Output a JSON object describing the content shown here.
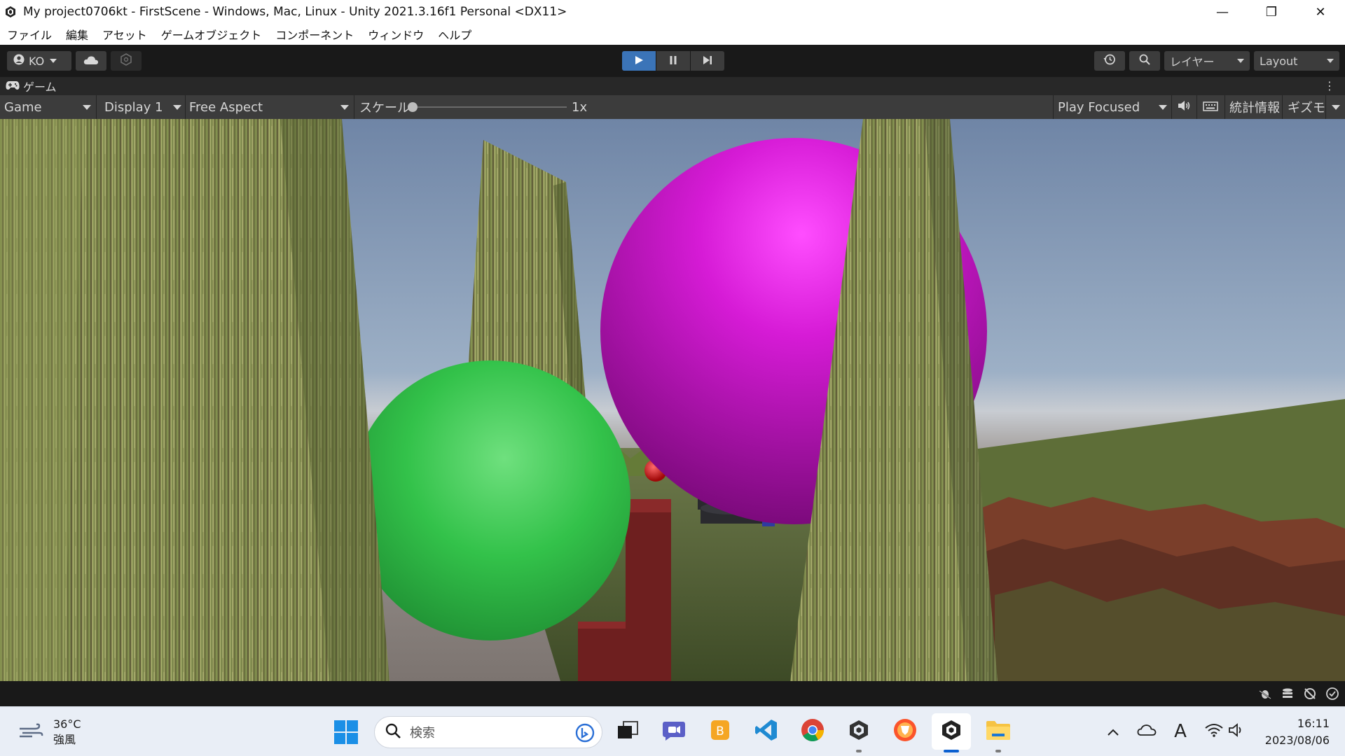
{
  "window": {
    "title": "My project0706kt - FirstScene - Windows, Mac, Linux - Unity 2021.3.16f1 Personal <DX11>",
    "minimize_glyph": "—",
    "maximize_glyph": "❐",
    "close_glyph": "✕"
  },
  "menu": [
    "ファイル",
    "編集",
    "アセット",
    "ゲームオブジェクト",
    "コンポーネント",
    "ウィンドウ",
    "ヘルプ"
  ],
  "toolbar": {
    "account_label": "KO",
    "layers_label": "レイヤー",
    "layout_label": "Layout",
    "play_state": "playing",
    "accent_color": "#3b74b8"
  },
  "game_tab": {
    "label": "ゲーム",
    "menu_glyph": "⋮"
  },
  "game_controls": {
    "view_label": "Game",
    "display_label": "Display 1",
    "aspect_label": "Free Aspect",
    "scale_label": "スケール",
    "scale_value": "1x",
    "play_mode_label": "Play Focused",
    "stats_label": "統計情報",
    "gizmos_label": "ギズモ"
  },
  "taskbar": {
    "weather_temp": "36°C",
    "weather_desc": "強風",
    "search_placeholder": "検索",
    "clock_time": "16:11",
    "clock_date": "2023/08/06",
    "ime_glyph": "A"
  }
}
